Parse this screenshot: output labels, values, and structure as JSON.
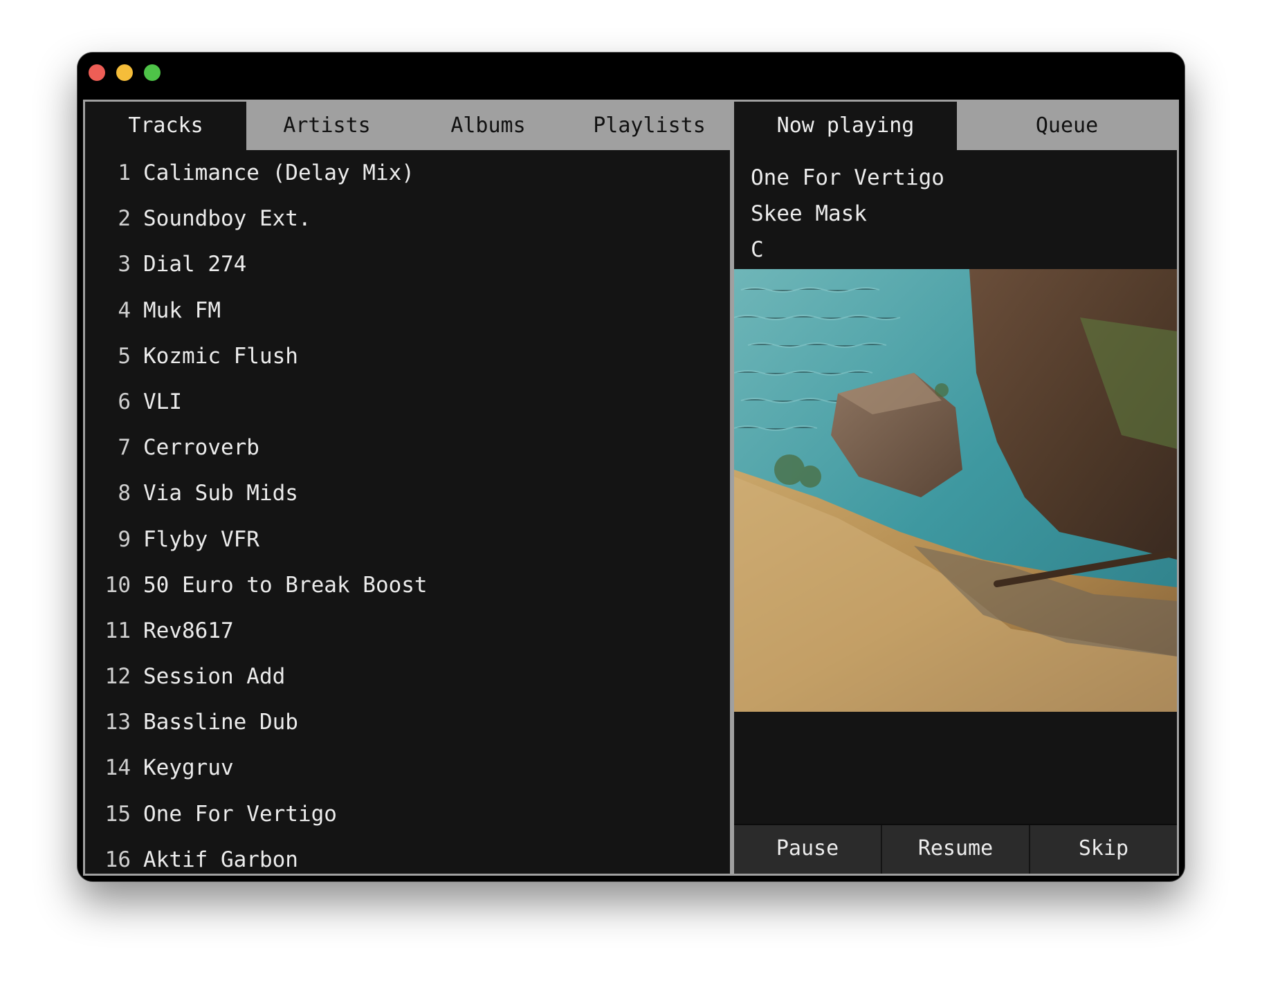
{
  "window": {
    "traffic_lights": [
      "close",
      "minimize",
      "zoom"
    ]
  },
  "library": {
    "tabs": [
      {
        "label": "Tracks",
        "active": true
      },
      {
        "label": "Artists",
        "active": false
      },
      {
        "label": "Albums",
        "active": false
      },
      {
        "label": "Playlists",
        "active": false
      }
    ],
    "tracks": [
      {
        "num": "1",
        "title": "Calimance (Delay Mix)"
      },
      {
        "num": "2",
        "title": "Soundboy Ext."
      },
      {
        "num": "3",
        "title": "Dial 274"
      },
      {
        "num": "4",
        "title": "Muk FM"
      },
      {
        "num": "5",
        "title": "Kozmic Flush"
      },
      {
        "num": "6",
        "title": "VLI"
      },
      {
        "num": "7",
        "title": "Cerroverb"
      },
      {
        "num": "8",
        "title": "Via Sub Mids"
      },
      {
        "num": "9",
        "title": "Flyby VFR"
      },
      {
        "num": "10",
        "title": "50 Euro to Break Boost"
      },
      {
        "num": "11",
        "title": "Rev8617"
      },
      {
        "num": "12",
        "title": "Session Add"
      },
      {
        "num": "13",
        "title": "Bassline Dub"
      },
      {
        "num": "14",
        "title": "Keygruv"
      },
      {
        "num": "15",
        "title": "One For Vertigo"
      },
      {
        "num": "16",
        "title": "Aktif Garbon"
      }
    ]
  },
  "player": {
    "tabs": [
      {
        "label": "Now playing",
        "active": true
      },
      {
        "label": "Queue",
        "active": false
      }
    ],
    "now_playing": {
      "title": "One For Vertigo",
      "artist": "Skee Mask",
      "album": "C"
    },
    "controls": {
      "pause": "Pause",
      "resume": "Resume",
      "skip": "Skip"
    }
  },
  "colors": {
    "panel_bg": "#141414",
    "tab_inactive_bg": "#a0a0a0",
    "button_bg": "#2b2b2b",
    "text": "#ececec"
  }
}
